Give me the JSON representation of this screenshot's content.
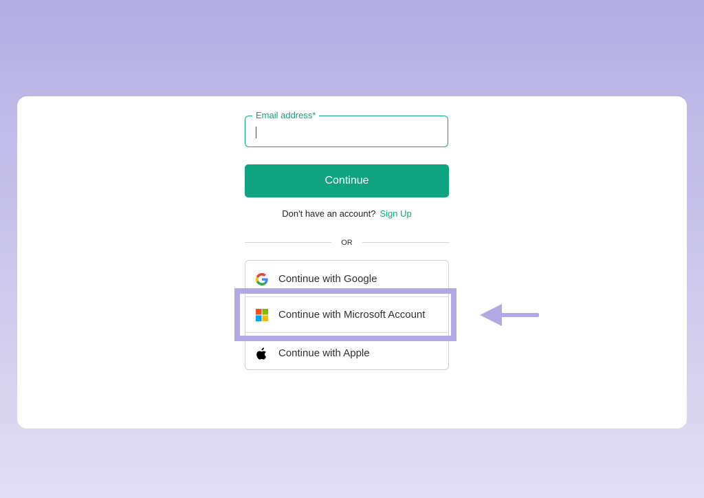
{
  "form": {
    "email_label": "Email address*",
    "email_value": "",
    "continue_label": "Continue",
    "no_account_text": "Don't have an account?",
    "signup_label": "Sign Up",
    "divider_text": "OR"
  },
  "social": {
    "google_label": "Continue with Google",
    "microsoft_label": "Continue with Microsoft Account",
    "apple_label": "Continue with Apple"
  },
  "colors": {
    "accent": "#10a37f",
    "highlight": "#b1a9e2",
    "background_top": "#b5afe3",
    "background_bottom": "#e2def3"
  },
  "icons": {
    "google": "google-icon",
    "microsoft": "microsoft-icon",
    "apple": "apple-icon",
    "annotation": "arrow-left-icon"
  }
}
